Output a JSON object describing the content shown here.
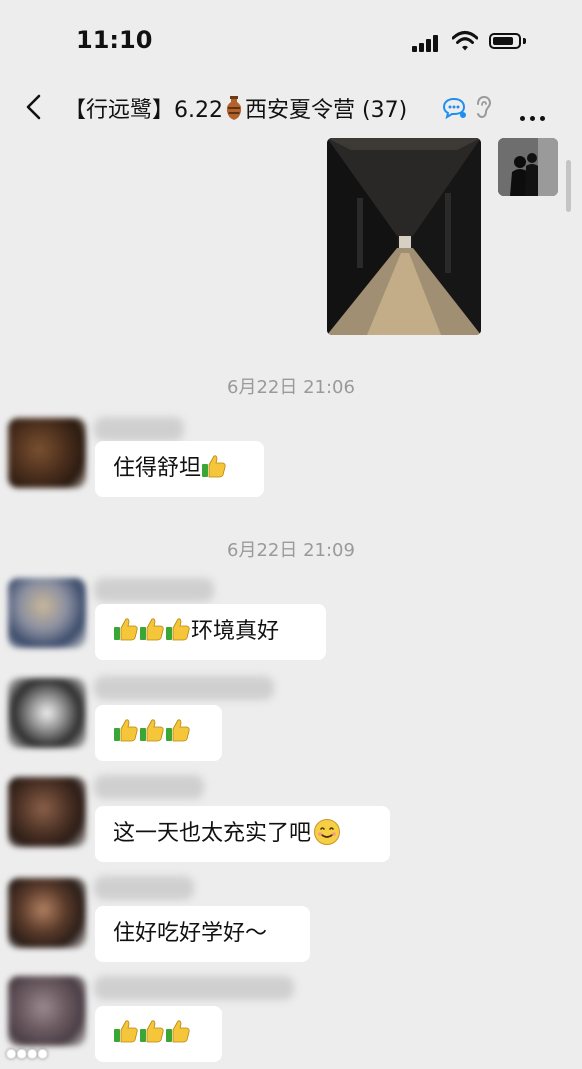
{
  "status_bar": {
    "time": "11:10"
  },
  "nav": {
    "title_prefix": "【行远鹭】6.22",
    "title_suffix": "西安夏令营 (37)",
    "title_icon": "vase-icon"
  },
  "messages": [
    {
      "type": "timestamp",
      "text": "6月22日 21:06"
    },
    {
      "type": "text",
      "text": "住得舒坦",
      "thumbs": 1,
      "thumbs_first": false
    },
    {
      "type": "timestamp",
      "text": "6月22日 21:09"
    },
    {
      "type": "text",
      "text": "环境真好",
      "thumbs": 3,
      "thumbs_first": true
    },
    {
      "type": "text",
      "text": "",
      "thumbs": 3,
      "thumbs_first": true
    },
    {
      "type": "text",
      "text": "这一天也太充实了吧",
      "emoji": "smile-icon"
    },
    {
      "type": "text",
      "text": "住好吃好学好～"
    },
    {
      "type": "text",
      "text": "",
      "thumbs": 3,
      "thumbs_first": true
    }
  ],
  "colors": {
    "background": "#ededed",
    "bubble": "#ffffff",
    "timestamp": "#9a9a9a",
    "accent": "#1f8ef1"
  }
}
